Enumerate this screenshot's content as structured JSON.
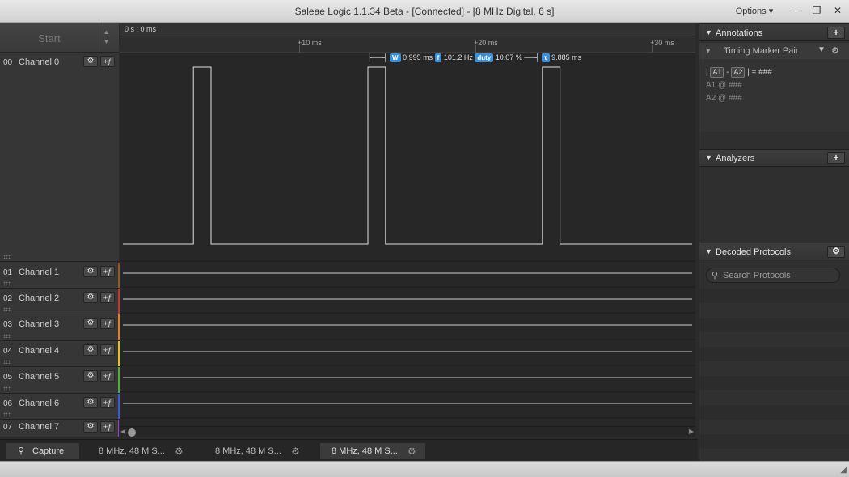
{
  "window": {
    "title": "Saleae Logic 1.1.34 Beta - [Connected] - [8 MHz Digital, 6 s]",
    "options_label": "Options ▾",
    "minimize_glyph": "─",
    "maximize_glyph": "❐",
    "close_glyph": "✕"
  },
  "capture": {
    "start_label": "Start"
  },
  "timeline": {
    "origin_label": "0 s : 0 ms",
    "ticks": [
      "+10 ms",
      "+20 ms",
      "+30 ms"
    ]
  },
  "measurement": {
    "width_badge": "W",
    "width": "0.995 ms",
    "freq_badge": "f",
    "frequency": "101.2 Hz",
    "duty_badge": "duty",
    "duty": "10.07 %",
    "period_badge": "τ",
    "period": "9.885 ms"
  },
  "channels": [
    {
      "num": "00",
      "name": "Channel 0",
      "color": "#4a4a4a"
    },
    {
      "num": "01",
      "name": "Channel 1",
      "color": "#8a5a2b"
    },
    {
      "num": "02",
      "name": "Channel 2",
      "color": "#c0392b"
    },
    {
      "num": "03",
      "name": "Channel 3",
      "color": "#e67e22"
    },
    {
      "num": "04",
      "name": "Channel 4",
      "color": "#e5c21b"
    },
    {
      "num": "05",
      "name": "Channel 5",
      "color": "#4caf2f"
    },
    {
      "num": "06",
      "name": "Channel 6",
      "color": "#3b5bd6"
    },
    {
      "num": "07",
      "name": "Channel 7",
      "color": "#a33bd6"
    }
  ],
  "channel0_pulses_ms": [
    [
      4.0,
      5.0
    ],
    [
      13.9,
      14.9
    ],
    [
      23.8,
      24.8
    ]
  ],
  "annotations": {
    "title": "Annotations",
    "marker_pair_label": "Timing Marker Pair",
    "formula_a1": "A1",
    "formula_a2": "A2",
    "formula_dash": "-",
    "formula_eq": "| = ###",
    "a1_line": "A1  @  ###",
    "a2_line": "A2  @  ###"
  },
  "analyzers": {
    "title": "Analyzers"
  },
  "decoded": {
    "title": "Decoded Protocols",
    "search_placeholder": "Search Protocols"
  },
  "tabs": [
    {
      "label": "Capture"
    },
    {
      "label": "8 MHz, 48 M S..."
    },
    {
      "label": "8 MHz, 48 M S..."
    },
    {
      "label": "8 MHz, 48 M S..."
    }
  ]
}
